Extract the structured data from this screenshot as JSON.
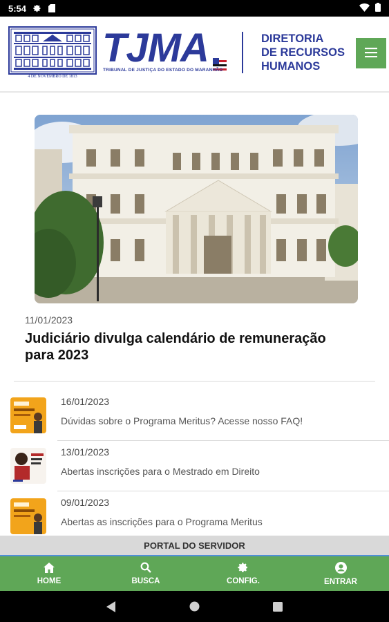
{
  "status_bar": {
    "time": "5:54",
    "icons": [
      "gear-icon",
      "sd-card-icon",
      "wifi-icon",
      "battery-icon"
    ]
  },
  "header": {
    "logo_text": "TJMA",
    "logo_subtitle": "TRIBUNAL DE JUSTIÇA DO ESTADO DO MARANHÃO",
    "logo_date": "4 DE NOVEMBRO DE 1813",
    "section_title_lines": [
      "DIRETORIA",
      "DE RECURSOS",
      "HUMANOS"
    ],
    "menu_icon": "hamburger-menu-icon"
  },
  "featured": {
    "date": "11/01/2023",
    "title": "Judiciário divulga calendário de remuneração para 2023"
  },
  "news": [
    {
      "date": "16/01/2023",
      "title": "Dúvidas sobre o Programa Meritus? Acesse nosso FAQ!"
    },
    {
      "date": "13/01/2023",
      "title": "Abertas inscrições para o Mestrado em Direito"
    },
    {
      "date": "09/01/2023",
      "title": "Abertas as inscrições para o Programa Meritus"
    }
  ],
  "portal_bar": {
    "label": "PORTAL DO SERVIDOR"
  },
  "bottom_nav": [
    {
      "label": "HOME",
      "icon": "home-icon"
    },
    {
      "label": "BUSCA",
      "icon": "search-icon"
    },
    {
      "label": "CONFIG.",
      "icon": "gear-icon"
    },
    {
      "label": "ENTRAR",
      "icon": "account-icon"
    }
  ],
  "colors": {
    "brand_blue": "#2c3a9a",
    "brand_green": "#5fa757",
    "portal_gray": "#d9d9d9"
  }
}
